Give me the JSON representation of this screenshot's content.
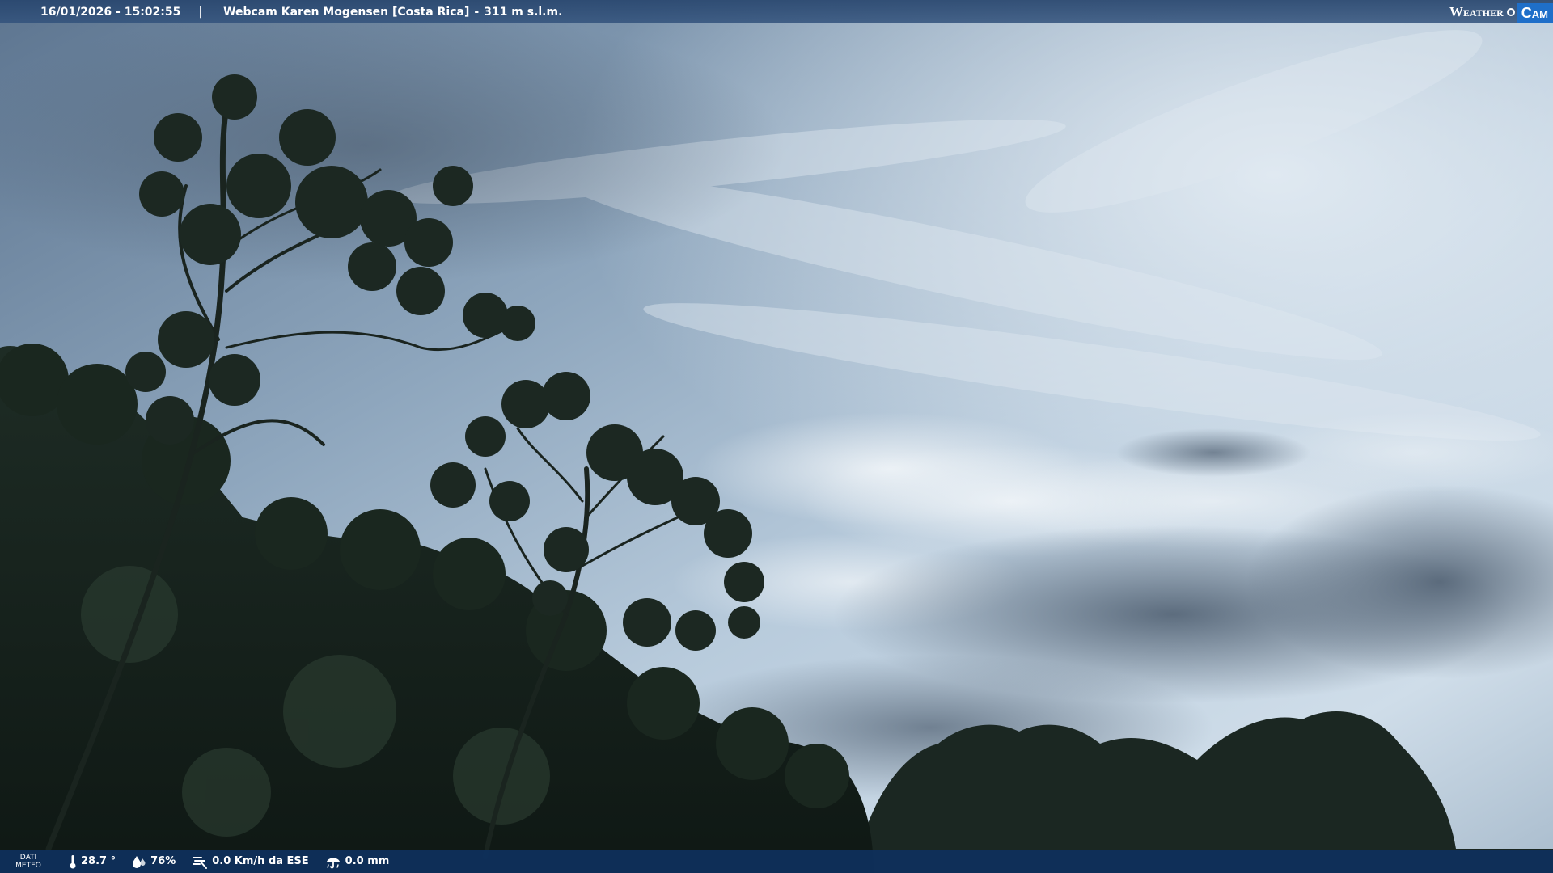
{
  "header": {
    "datetime": "16/01/2026 - 15:02:55",
    "separator": "|",
    "webcam_name": "Webcam Karen Mogensen [Costa Rica]",
    "dash": "-",
    "altitude": "311 m s.l.m.",
    "brand_left": "Weather",
    "brand_right": "Cam",
    "brand_color": "#1f6fc9"
  },
  "footer": {
    "label_line1": "DATI",
    "label_line2": "METEO",
    "temperature": "28.7 °",
    "humidity": "76%",
    "wind": "0.0 Km/h da ESE",
    "rain": "0.0 mm",
    "icons": [
      "thermometer-icon",
      "humidity-drop-icon",
      "wind-icon",
      "rain-icon"
    ]
  },
  "colors": {
    "top_bar": "#2f5380",
    "bottom_bar": "#0e305c",
    "sky_light": "#c6d6e4",
    "sky_dark": "#5b6f85",
    "vegetation": "#16221c"
  }
}
